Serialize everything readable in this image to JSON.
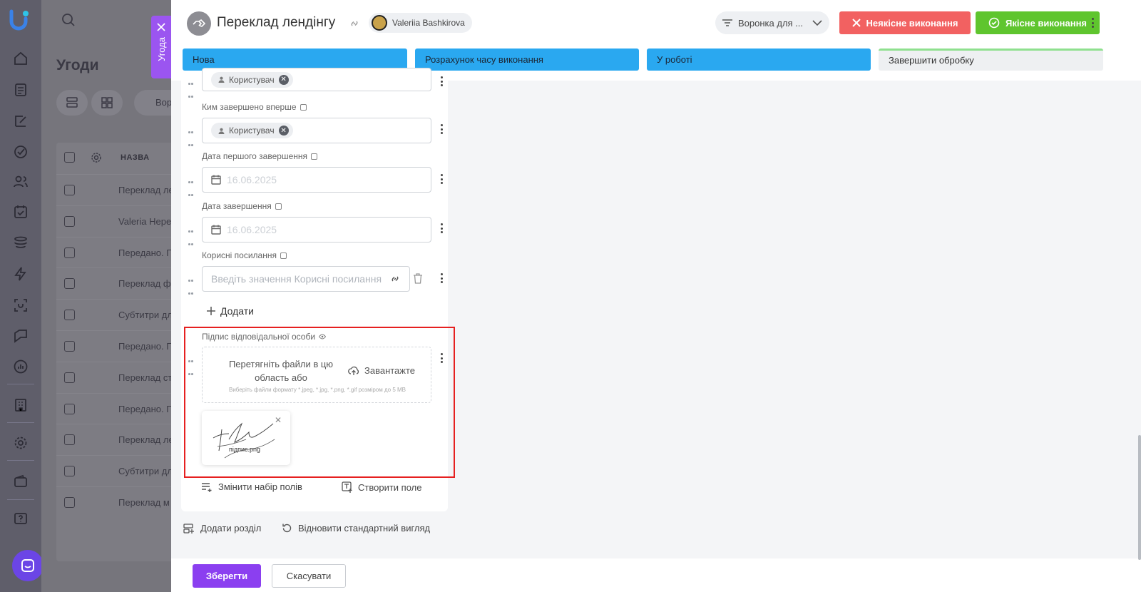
{
  "background": {
    "title": "Угоди",
    "filter_label": "Вор",
    "table_header": "НАЗВА",
    "rows": [
      "Переклад ле",
      "Valeria Hepe",
      "Передано. П",
      "Переклад ф",
      "Субтитри дл",
      "Передано. П",
      "Переклад ст",
      "Передано. П",
      "Переклад ле",
      "Субтитри дл",
      "Переклад м"
    ]
  },
  "side_tab": {
    "label": "Угода"
  },
  "header": {
    "title": "Переклад лендінгу",
    "user_name": "Valeriia Bashkirova",
    "funnel_label": "Воронка для ...",
    "bad_button": "Неякісне виконання",
    "good_button": "Якісне виконання"
  },
  "stages": [
    {
      "label": "Нова",
      "state": "active"
    },
    {
      "label": "Розрахунок часу виконання",
      "state": "active"
    },
    {
      "label": "У роботі",
      "state": "active"
    },
    {
      "label": "Завершити обробку",
      "state": "pending"
    }
  ],
  "form": {
    "top_chip": "Користувач",
    "completed_first_by": {
      "label": "Ким завершено вперше",
      "chip": "Користувач"
    },
    "first_completion_date": {
      "label": "Дата першого завершення",
      "value": "16.06.2025"
    },
    "completion_date": {
      "label": "Дата завершення",
      "value": "16.06.2025"
    },
    "useful_links": {
      "label": "Корисні посилання",
      "placeholder": "Введіть значення Корисні посилання"
    },
    "add_label": "Додати",
    "signature": {
      "label": "Підпис відповідальної особи",
      "drop_text": "Перетягніть файли в цю область або",
      "upload_label": "Завантажте",
      "hint": "Виберіть файли формату *.jpeg, *.jpg, *.png, *.gif розміром до 5 MB",
      "file_name": "підпис.png"
    },
    "change_fields": "Змінити набір полів",
    "create_field": "Створити поле"
  },
  "below_card": {
    "add_section": "Додати розділ",
    "restore_view": "Відновити стандартний вигляд"
  },
  "footer": {
    "save": "Зберегти",
    "cancel": "Скасувати"
  },
  "colors": {
    "accent": "#8b3ff0",
    "stage_active": "#2aa8f0",
    "bad": "#f26161",
    "good": "#5fc52e",
    "highlight": "#e62020"
  }
}
